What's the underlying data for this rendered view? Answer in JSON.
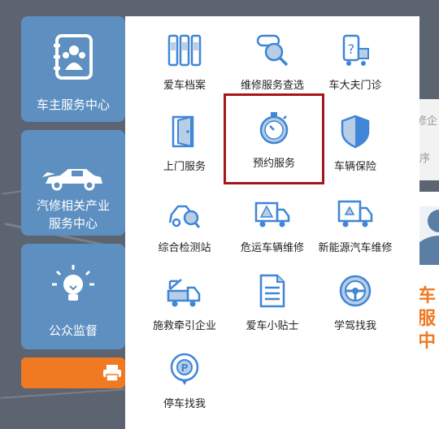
{
  "sidebar": {
    "cards": [
      {
        "label": "车主服务中心",
        "icon": "owner-book-icon"
      },
      {
        "label_line1": "汽修相关产业",
        "label_line2": "服务中心",
        "icon": "car-icon"
      },
      {
        "label": "公众监督",
        "icon": "lightbulb-icon"
      }
    ],
    "bottom_button_icon": "printer-icon"
  },
  "services": [
    {
      "label": "爱车档案",
      "icon": "binders-icon"
    },
    {
      "label": "维修服务查选",
      "icon": "magnifier-icon"
    },
    {
      "label": "车大夫门诊",
      "icon": "doctor-truck-icon"
    },
    {
      "label": "上门服务",
      "icon": "door-icon"
    },
    {
      "label": "预约服务",
      "icon": "stopwatch-icon",
      "selected": true
    },
    {
      "label": "车辆保险",
      "icon": "shield-icon"
    },
    {
      "label": "综合检测站",
      "icon": "inspection-car-icon"
    },
    {
      "label": "危运车辆维修",
      "icon": "hazard-truck-icon"
    },
    {
      "label": "新能源汽车维修",
      "icon": "recycle-truck-icon"
    },
    {
      "label": "施救牵引企业",
      "icon": "tow-truck-icon"
    },
    {
      "label": "爱车小贴士",
      "icon": "document-icon"
    },
    {
      "label": "学驾找我",
      "icon": "steering-wheel-icon"
    },
    {
      "label": "停车找我",
      "icon": "parking-pin-icon"
    }
  ],
  "right_partial": {
    "gray_text_1": "修企",
    "gray_text_2": "序",
    "orange_chars": [
      "车",
      "服",
      "中"
    ]
  },
  "colors": {
    "card_blue": "#5d8fc0",
    "icon_blue": "#3f86d6",
    "orange": "#ef7a22",
    "highlight_red": "#a3161a"
  }
}
